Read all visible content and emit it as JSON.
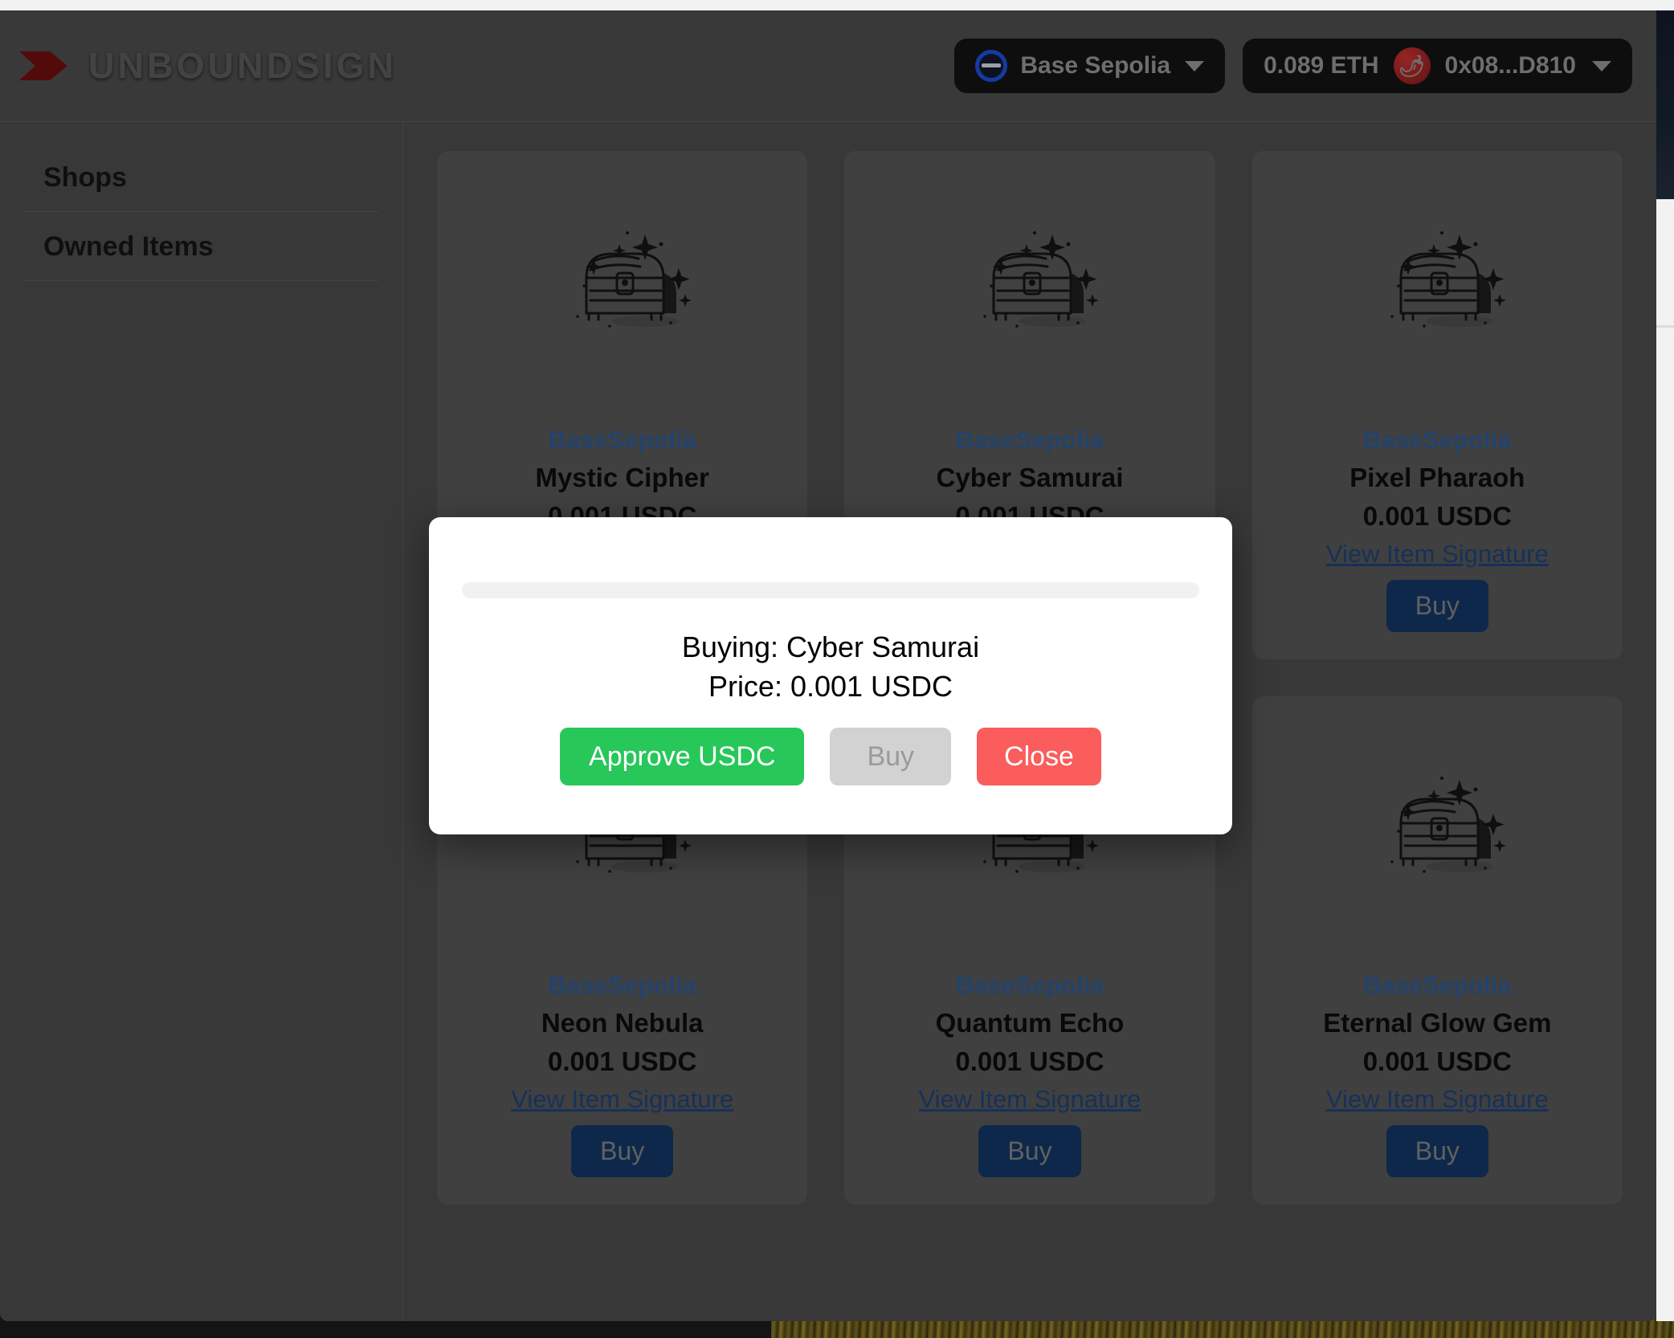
{
  "app": {
    "brand_name": "UNBOUNDSIGN",
    "logo_icon": "arrow-chevron-logo-icon"
  },
  "header": {
    "network": {
      "label": "Base Sepolia",
      "icon": "base-chain-icon",
      "chevron": "chevron-down-icon"
    },
    "wallet": {
      "balance": "0.089 ETH",
      "address": "0x08...D810",
      "avatar_icon": "chili-pepper-avatar",
      "avatar_glyph": "🌶",
      "chevron": "chevron-down-icon"
    }
  },
  "sidebar": {
    "items": [
      {
        "label": "Shops"
      },
      {
        "label": "Owned Items"
      }
    ]
  },
  "main": {
    "link_label": "View Item Signature",
    "buy_label": "Buy",
    "art_icon": "treasure-chest-icon",
    "cards": [
      {
        "chain": "BaseSepolia",
        "name": "Mystic Cipher",
        "price": "0.001 USDC"
      },
      {
        "chain": "BaseSepolia",
        "name": "Cyber Samurai",
        "price": "0.001 USDC"
      },
      {
        "chain": "BaseSepolia",
        "name": "Pixel Pharaoh",
        "price": "0.001 USDC"
      },
      {
        "chain": "BaseSepolia",
        "name": "Neon Nebula",
        "price": "0.001 USDC"
      },
      {
        "chain": "BaseSepolia",
        "name": "Quantum Echo",
        "price": "0.001 USDC"
      },
      {
        "chain": "BaseSepolia",
        "name": "Eternal Glow Gem",
        "price": "0.001 USDC"
      }
    ]
  },
  "modal": {
    "buying_text": "Buying: Cyber Samurai",
    "price_text": "Price: 0.001 USDC",
    "approve_label": "Approve USDC",
    "buy_label": "Buy",
    "close_label": "Close",
    "approve_color": "#27c75a",
    "close_color": "#fb5c5c",
    "buy_disabled_color": "#d2d2d2"
  },
  "colors": {
    "app_bg": "#484848",
    "card_bg": "#525252",
    "chain_text": "#2d5789",
    "link_text": "#1d3f72",
    "buy_button": "#123461",
    "logo_red": "#6b0d0d"
  }
}
